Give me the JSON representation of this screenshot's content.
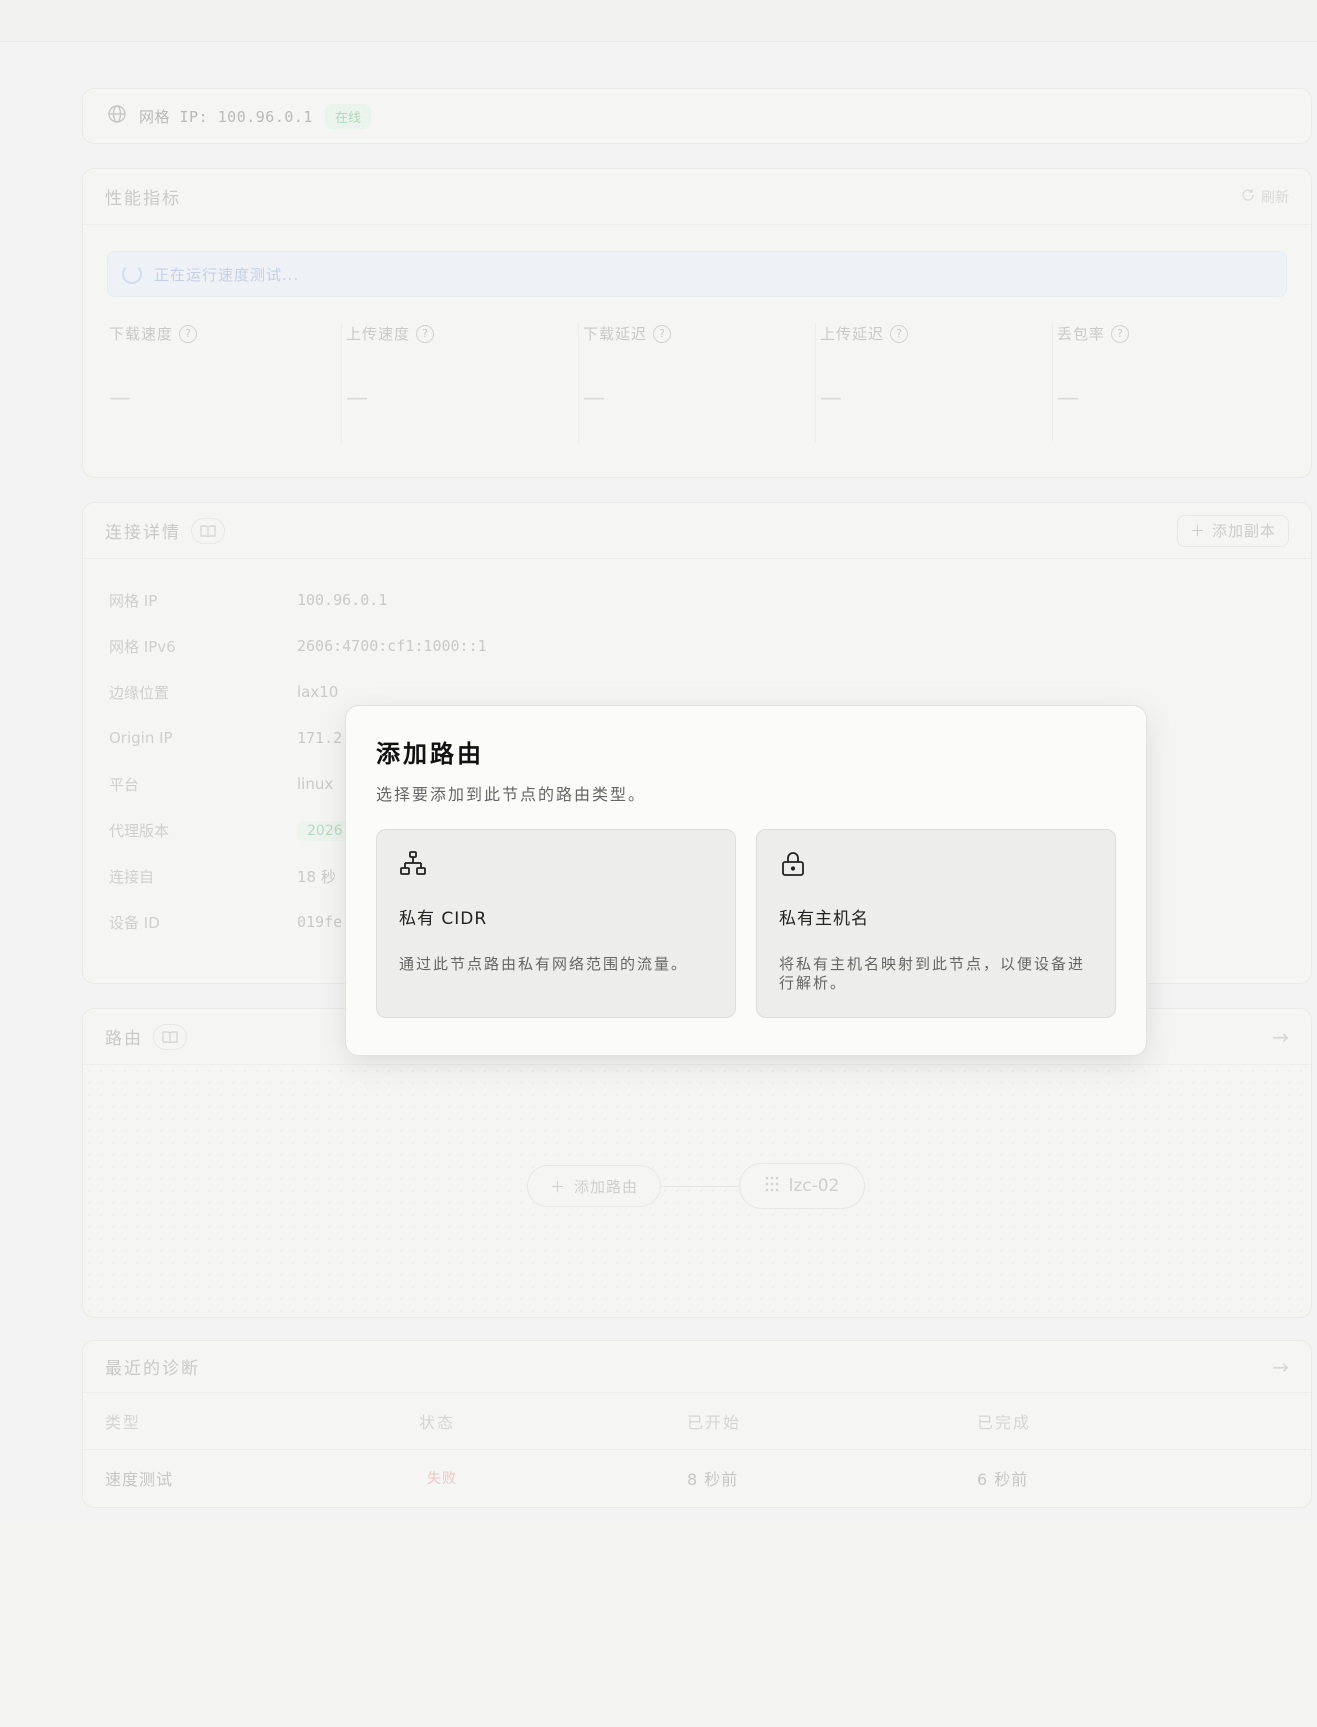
{
  "mesh": {
    "label_ip": "网格 IP: 100.96.0.1",
    "status": "在线"
  },
  "perf": {
    "title": "性能指标",
    "refresh": "刷新",
    "banner": "正在运行速度测试...",
    "metrics": [
      {
        "label": "下载速度",
        "value": "—"
      },
      {
        "label": "上传速度",
        "value": "—"
      },
      {
        "label": "下载延迟",
        "value": "—"
      },
      {
        "label": "上传延迟",
        "value": "—"
      },
      {
        "label": "丢包率",
        "value": "—"
      }
    ]
  },
  "conn": {
    "title": "连接详情",
    "add_replica": "添加副本",
    "rows": [
      {
        "key": "网格 IP",
        "value": "100.96.0.1"
      },
      {
        "key": "网格 IPv6",
        "value": "2606:4700:cf1:1000::1"
      },
      {
        "key": "边缘位置",
        "value": "lax10"
      },
      {
        "key": "Origin IP",
        "value": "171.2"
      },
      {
        "key": "平台",
        "value": "linux"
      },
      {
        "key": "代理版本",
        "value": "2026"
      },
      {
        "key": "连接自",
        "value": "18 秒"
      },
      {
        "key": "设备 ID",
        "value": "019fe"
      }
    ]
  },
  "routes": {
    "title": "路由",
    "add_route": "添加路由",
    "node_name": "lzc-02"
  },
  "diag": {
    "title": "最近的诊断",
    "columns": [
      "类型",
      "状态",
      "已开始",
      "已完成"
    ],
    "rows": [
      {
        "type": "速度测试",
        "status": "失败",
        "started": "8 秒前",
        "finished": "6 秒前"
      }
    ]
  },
  "modal": {
    "title": "添加路由",
    "subtitle": "选择要添加到此节点的路由类型。",
    "options": [
      {
        "icon": "network-icon",
        "title": "私有 CIDR",
        "desc": "通过此节点路由私有网络范围的流量。"
      },
      {
        "icon": "lock-icon",
        "title": "私有主机名",
        "desc": "将私有主机名映射到此节点，以便设备进行解析。"
      }
    ]
  }
}
